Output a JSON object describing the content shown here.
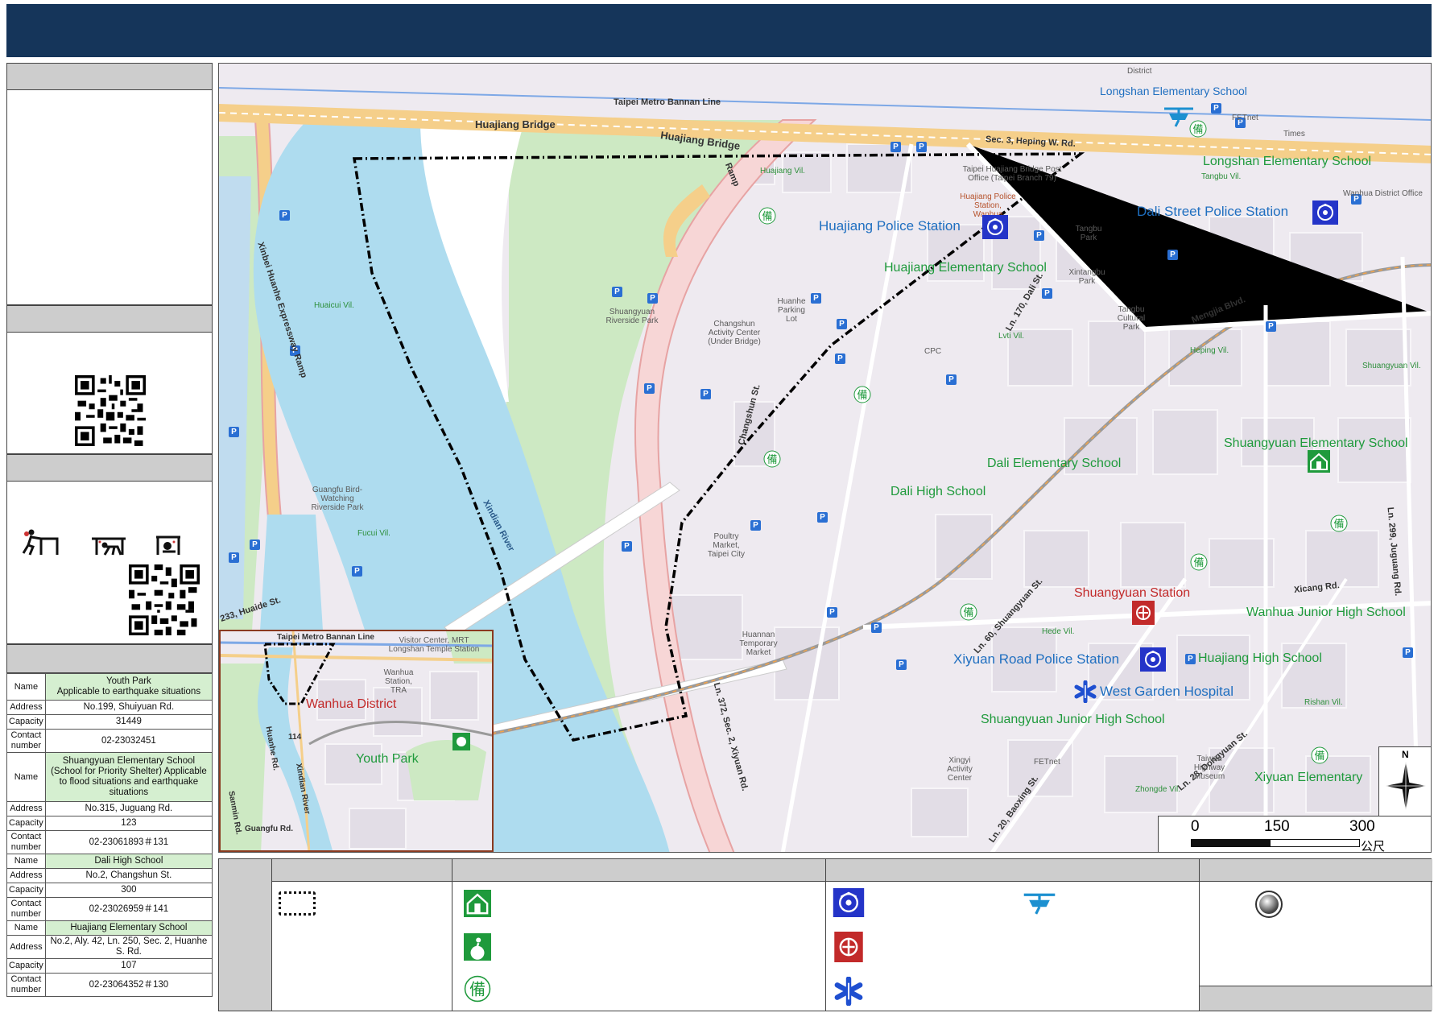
{
  "map": {
    "area_labels": {
      "wanhua_district": "Wanhua District",
      "youth_park": "Youth Park",
      "dali_hs": "Dali High School",
      "dali_es": "Dali Elementary School",
      "huajiang_es": "Huajiang Elementary School",
      "longshan_es_1": "Longshan Elementary School",
      "longshan_es_2": "Longshan Elementary School",
      "shuangyuan_es": "Shuangyuan Elementary School",
      "wanhua_jhs": "Wanhua Junior High School",
      "huajiang_hs": "Huajiang High School",
      "shuangyuan_jhs": "Shuangyuan Junior High School",
      "xiyuan_es": "Xiyuan Elementary",
      "huajiang_police": "Huajiang Police Station",
      "dali_police": "Dali Street Police Station",
      "xiyuan_police": "Xiyuan Road Police Station",
      "west_garden_hospital": "West Garden Hospital",
      "shuangyuan_station": "Shuangyuan Station"
    },
    "road_labels": {
      "metro": "Taipei Metro Bannan Line",
      "bridge": "Huajiang Bridge",
      "bridge2": "Huajiang Bridge",
      "ramp": "Ramp",
      "heping": "Sec. 3, Heping W. Rd.",
      "river": "Xindian River",
      "xinbei": "Xinbei Huanhe Expressway Ramp",
      "mengjia": "Mengjia Blvd.",
      "changshun": "Changshun St.",
      "xicang": "Xicang Rd.",
      "juguang": "Ln. 299, Juguang Rd.",
      "xiyuan": "Ln. 372, Sec. 2, Xiyuan Rd.",
      "dongyuan": "Ln. 28, Dongyuan St.",
      "shuangyuan": "Ln. 60, Shuangyuan St.",
      "baoxing": "Ln. 20, Baoxing St.",
      "huaide": "233, Huaide St.",
      "dali": "Ln. 170, Dali St."
    },
    "small_labels": {
      "huajiang_vil": "Huajiang Vil.",
      "huaicui_vil": "Huaicui Vil.",
      "fucui_vil": "Fucui Vil.",
      "lvti_vil": "Lvti Vil.",
      "heping_vil": "Heping Vil.",
      "tangbu_vil": "Tangbu Vil.",
      "hede_vil": "Hede Vil.",
      "zhongde_vil": "Zhongde Vil.",
      "rishan_vil": "Rishan Vil.",
      "shuangyuan_vil": "Shuangyuan Vil.",
      "district": "District",
      "guangfu_park": "Guangfu Bird-Watching Riverside Park",
      "shuangyuan_park": "Shuangyuan Riverside Park",
      "changshun_center": "Changshun Activity Center (Under Bridge)",
      "poultry_market": "Poultry Market, Taipei City",
      "huannan_market": "Huannan Temporary Market",
      "fetnet": "FETnet",
      "post_office": "Taipei Huajiang Bridge Post Office (Taipei Branch 79)",
      "police_small": "Huajiang Police Station, Wanhua",
      "cpc": "CPC",
      "taiwan_museum": "Taiwan Highway Museum",
      "tangbu_park": "Tangbu Park",
      "xintangbu_park": "Xintangbu Park",
      "tangbu_cultural": "Tangbu Cultural Park",
      "xingyi_center": "Xingyi Activity Center",
      "wanhua_district_office": "Wanhua District Office",
      "times": "Times",
      "hsinhuan": "Huanhe Parking Lot"
    },
    "inset_labels": {
      "metro": "Taipei Metro Bannan Line",
      "visitor": "Visitor Center, MRT Longshan Temple Station",
      "wanhua_station": "Wanhua Station, TRA",
      "xindian": "Xindian River",
      "road114": "114",
      "sanmin": "Sanmin Rd.",
      "huanhe": "Huanhe Rd.",
      "guangfu": "Guangfu Rd."
    },
    "scale": {
      "ticks": [
        "0",
        "150",
        "300"
      ],
      "unit": "公尺"
    },
    "north_label": "N"
  },
  "shelters": [
    {
      "name_key": "Name",
      "name": "Youth Park\nApplicable to earthquake situations",
      "address_key": "Address",
      "address": "No.199, Shuiyuan Rd.",
      "capacity_key": "Capacity",
      "capacity": "31449",
      "contact_key": "Contact number",
      "contact": "02-23032451"
    },
    {
      "name_key": "Name",
      "name": "Shuangyuan Elementary School (School for Priority Shelter) Applicable to flood situations and earthquake situations",
      "address_key": "Address",
      "address": "No.315, Juguang Rd.",
      "capacity_key": "Capacity",
      "capacity": "123",
      "contact_key": "Contact number",
      "contact": "02-23061893＃131"
    },
    {
      "name_key": "Name",
      "name": "Dali High School",
      "address_key": "Address",
      "address": "No.2, Changshun St.",
      "capacity_key": "Capacity",
      "capacity": "300",
      "contact_key": "Contact number",
      "contact": "02-23026959＃141"
    },
    {
      "name_key": "Name",
      "name": "Huajiang Elementary School",
      "address_key": "Address",
      "address": "No.2, Aly. 42, Ln. 250, Sec. 2, Huanhe S. Rd.",
      "capacity_key": "Capacity",
      "capacity": "107",
      "contact_key": "Contact number",
      "contact": "02-23064352＃130"
    }
  ],
  "colors": {
    "header": "#15355a",
    "river": "#aedcef",
    "park": "#cde9c3",
    "expressway": "#f5cf8a",
    "shelter_green": "#1f9a3c",
    "police_blue": "#1f6fc0",
    "fire_red": "#c22a2a"
  }
}
